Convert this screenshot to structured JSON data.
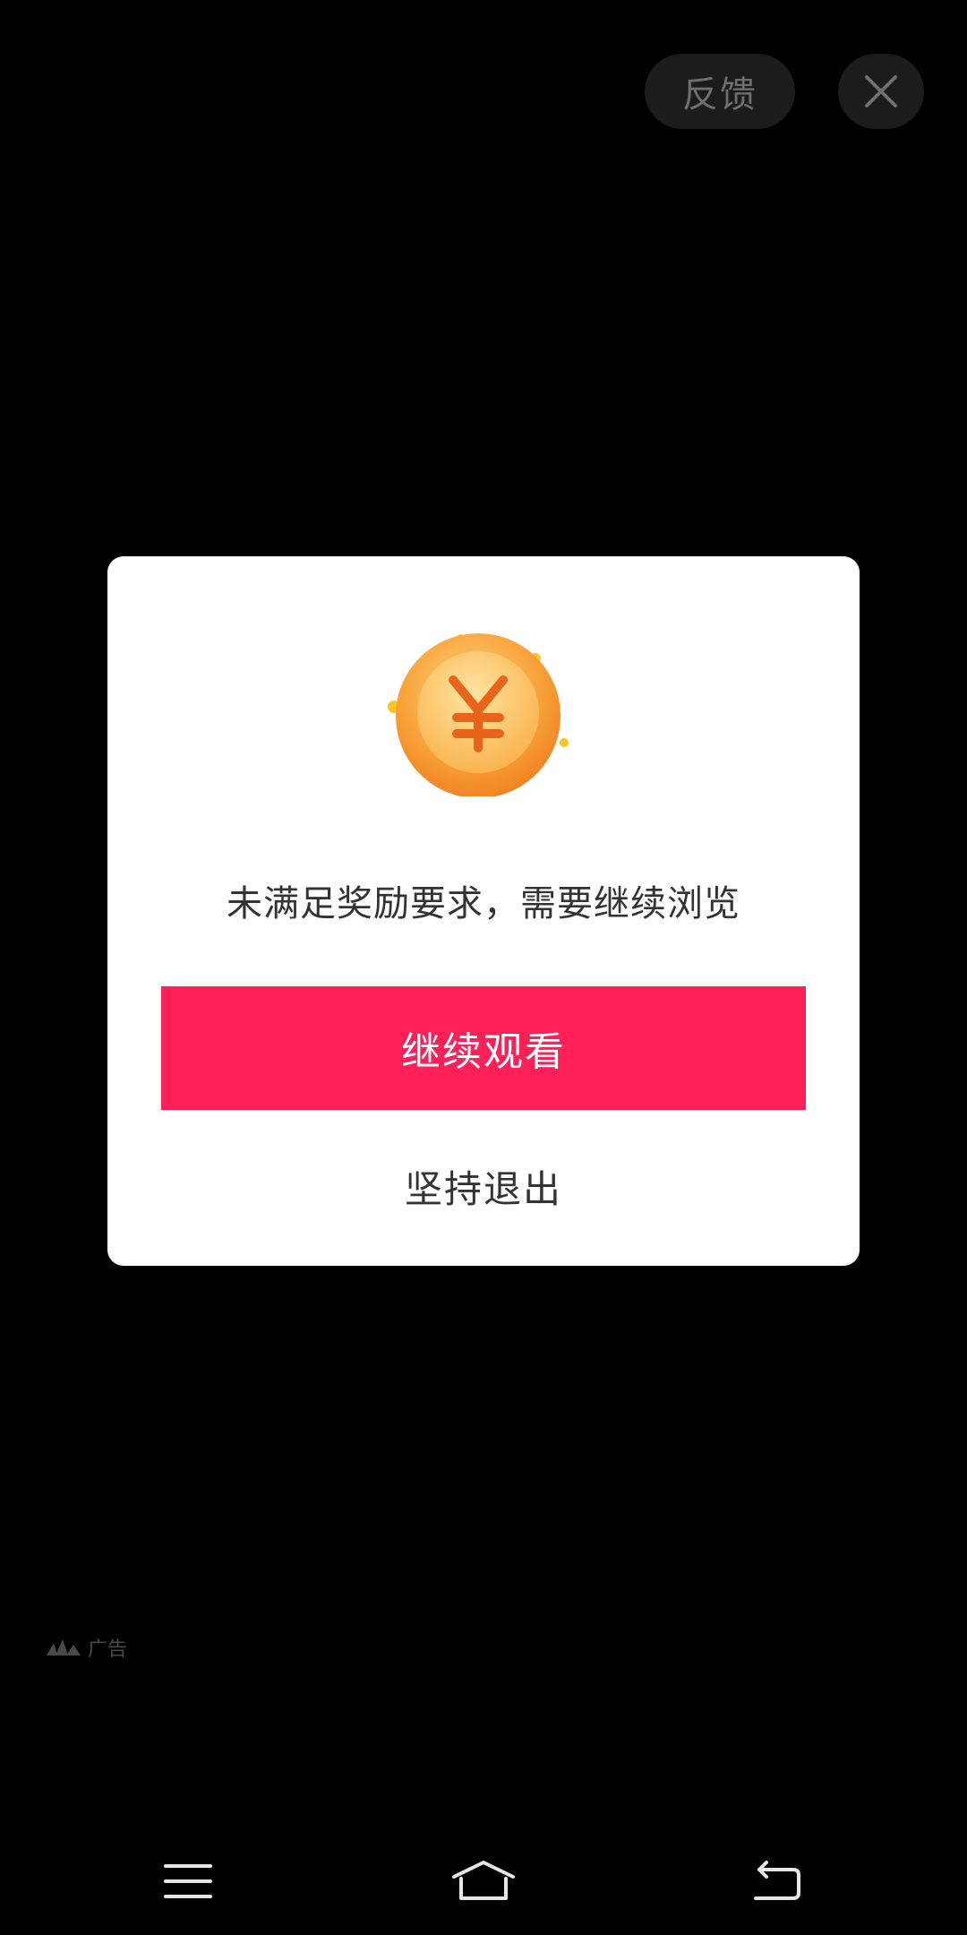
{
  "top_bar": {
    "feedback_label": "反馈",
    "close_icon": "close-icon"
  },
  "dialog": {
    "icon": "yuan-coin-icon",
    "message": "未满足奖励要求，需要继续浏览",
    "primary_button": "继续观看",
    "secondary_button": "坚持退出"
  },
  "ad_badge": {
    "icon": "ad-network-logo-icon",
    "label": "广告"
  },
  "nav_bar": {
    "menu_icon": "menu-icon",
    "home_icon": "home-icon",
    "back_icon": "back-icon"
  },
  "colors": {
    "background": "#000000",
    "dialog_bg": "#ffffff",
    "primary_button": "#fe2057",
    "text": "#333333",
    "coin": "#f7a233"
  }
}
